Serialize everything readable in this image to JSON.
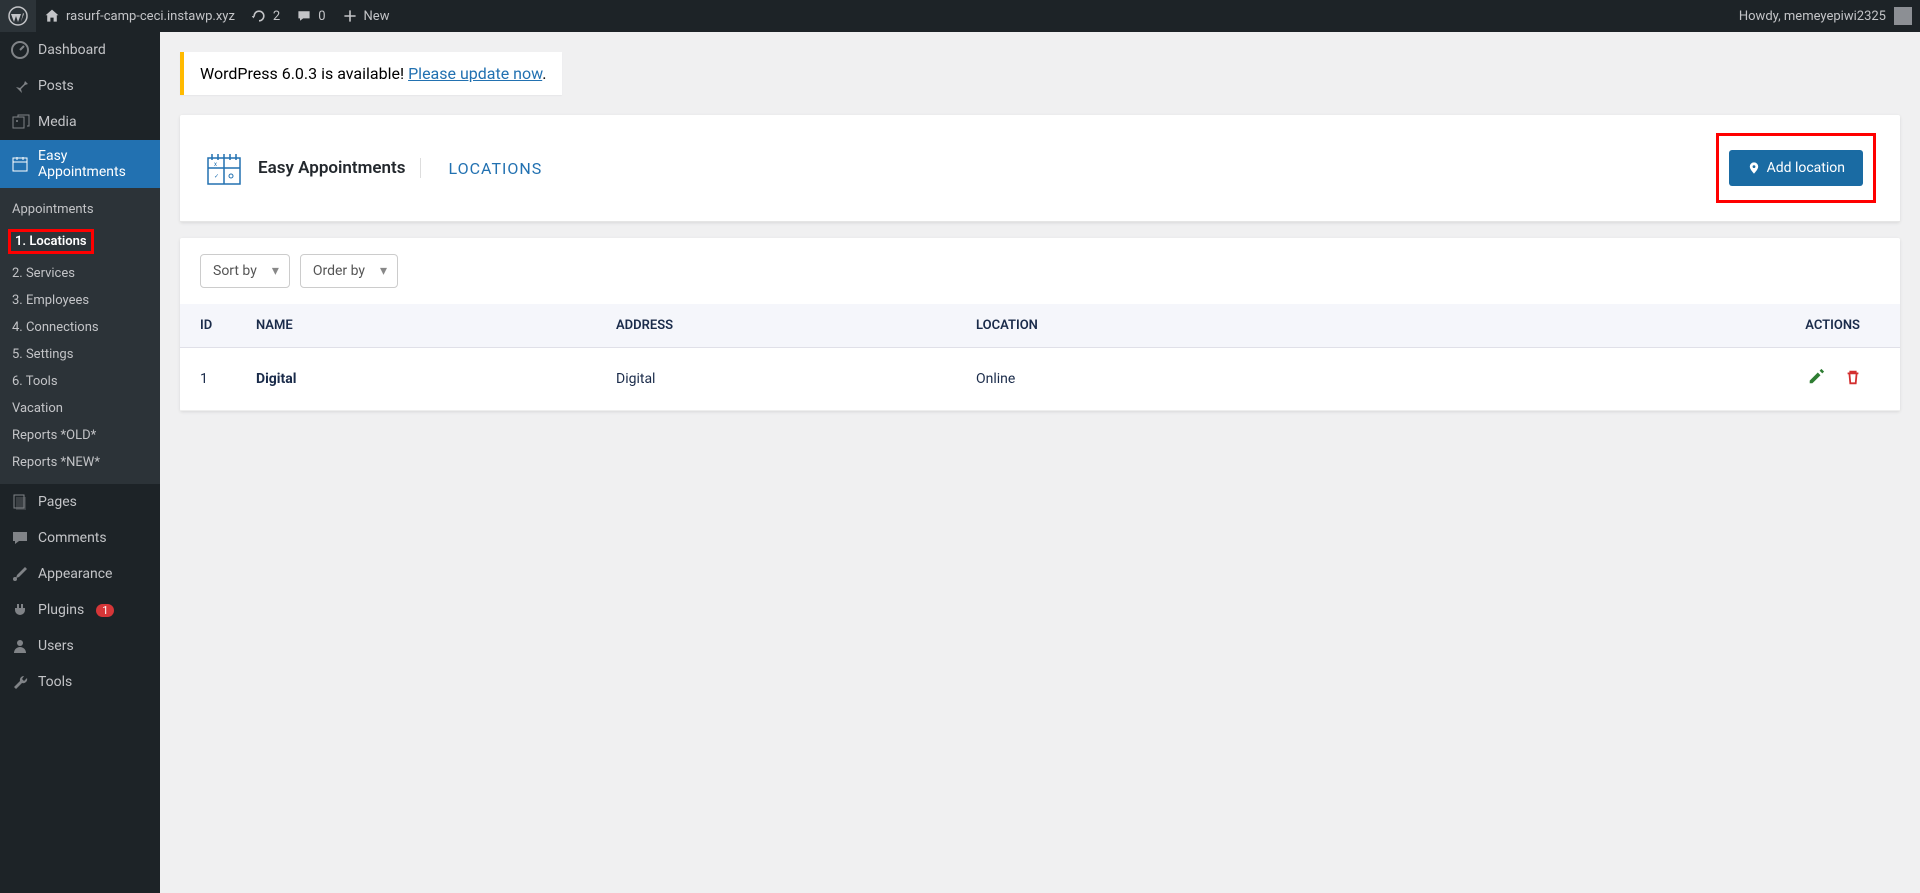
{
  "adminBar": {
    "siteName": "rasurf-camp-ceci.instawp.xyz",
    "updates": "2",
    "comments": "0",
    "new": "New",
    "howdy": "Howdy, memeyepiwi2325"
  },
  "sidebar": {
    "dashboard": "Dashboard",
    "posts": "Posts",
    "media": "Media",
    "easyAppointments": "Easy Appointments",
    "submenu": {
      "appointments": "Appointments",
      "locations": "1. Locations",
      "services": "2. Services",
      "employees": "3. Employees",
      "connections": "4. Connections",
      "settings": "5. Settings",
      "tools": "6. Tools",
      "vacation": "Vacation",
      "reportsOld": "Reports *OLD*",
      "reportsNew": "Reports *NEW*"
    },
    "pages": "Pages",
    "comments": "Comments",
    "appearance": "Appearance",
    "plugins": "Plugins",
    "pluginsBadge": "1",
    "users": "Users",
    "tools": "Tools"
  },
  "notice": {
    "text": "WordPress 6.0.3 is available! ",
    "link": "Please update now"
  },
  "header": {
    "appName": "Easy Appointments",
    "pageLabel": "LOCATIONS",
    "addButton": "Add location"
  },
  "toolbar": {
    "sortBy": "Sort by",
    "orderBy": "Order by"
  },
  "table": {
    "headers": {
      "id": "ID",
      "name": "NAME",
      "address": "ADDRESS",
      "location": "LOCATION",
      "actions": "ACTIONS"
    },
    "rows": [
      {
        "id": "1",
        "name": "Digital",
        "address": "Digital",
        "location": "Online"
      }
    ]
  }
}
